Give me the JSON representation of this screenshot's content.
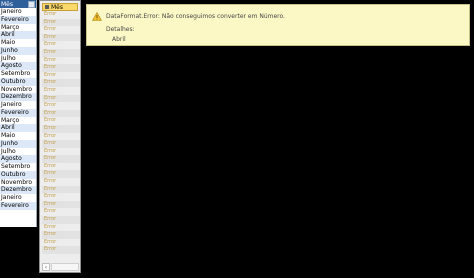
{
  "left_table": {
    "header": "Mês",
    "rows": [
      "Janeiro",
      "Fevereiro",
      "Março",
      "Abril",
      "Maio",
      "Junho",
      "Julho",
      "Agosto",
      "Setembro",
      "Outubro",
      "Novembro",
      "Dezembro",
      "Janeiro",
      "Fevereiro",
      "Março",
      "Abril",
      "Maio",
      "Junho",
      "Julho",
      "Agosto",
      "Setembro",
      "Outubro",
      "Novembro",
      "Dezembro",
      "Janeiro",
      "Fevereiro"
    ]
  },
  "error_column": {
    "header": "Mês",
    "cells": [
      "Error",
      "Error",
      "Error",
      "Error",
      "Error",
      "Error",
      "Error",
      "Error",
      "Error",
      "Error",
      "Error",
      "Error",
      "Error",
      "Error",
      "Error",
      "Error",
      "Error",
      "Error",
      "Error",
      "Error",
      "Error",
      "Error",
      "Error",
      "Error",
      "Error",
      "Error",
      "Error",
      "Error",
      "Error",
      "Error",
      "Error",
      "Error"
    ]
  },
  "error_banner": {
    "title": "DataFormat.Error: Não conseguimos converter em Número.",
    "details_label": "Detalhes:",
    "details_value": "Abril"
  },
  "colors": {
    "header_blue": "#2f5f9a",
    "row_alt": "#dce8f7",
    "banner_bg": "#fcf8c6",
    "error_text": "#c4a04a"
  }
}
